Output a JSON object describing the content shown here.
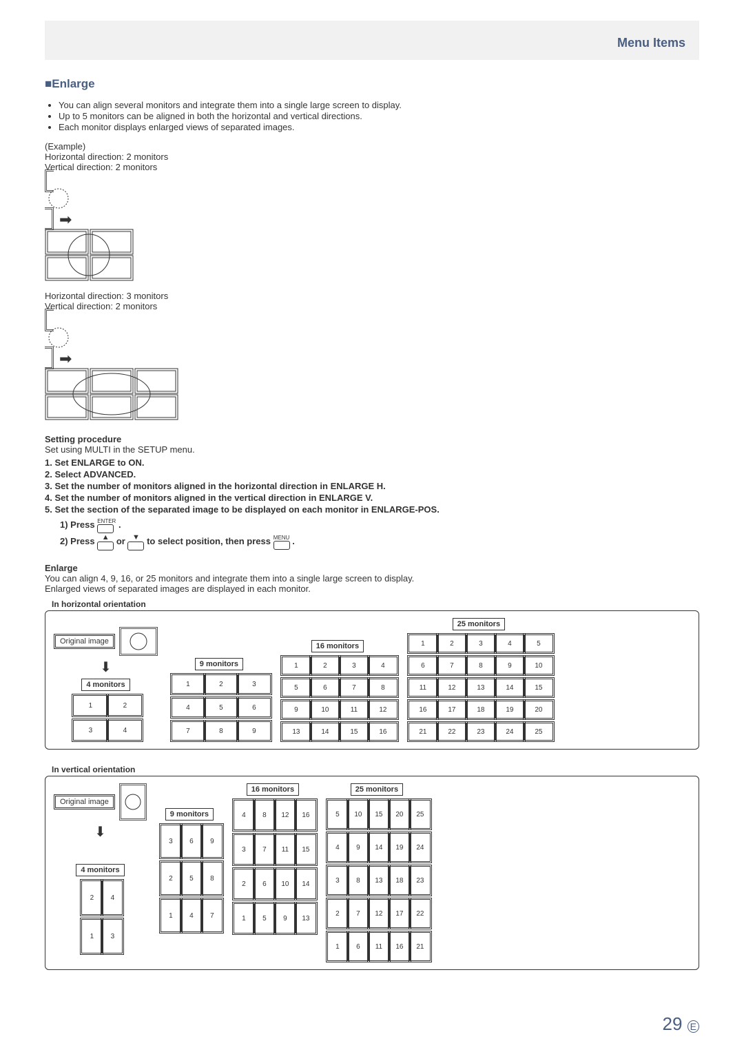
{
  "header": {
    "title": "Menu Items"
  },
  "section": {
    "title": "■Enlarge",
    "bullets": [
      "You can align several monitors and integrate them into a single large screen to display.",
      "Up to 5 monitors can be aligned in both the horizontal and vertical directions.",
      "Each monitor displays enlarged views of separated images."
    ],
    "example_label": "(Example)",
    "ex1": {
      "h": "Horizontal direction: 2 monitors",
      "v": "Vertical direction: 2 monitors"
    },
    "ex2": {
      "h": "Horizontal direction: 3 monitors",
      "v": "Vertical direction: 2 monitors"
    }
  },
  "procedure": {
    "heading": "Setting procedure",
    "intro": "Set using MULTI in the SETUP menu.",
    "steps": [
      "1. Set ENLARGE to ON.",
      "2. Select ADVANCED.",
      "3. Set the number of monitors aligned in the horizontal direction in ENLARGE H.",
      "4. Set the number of monitors aligned in the vertical direction in ENLARGE V.",
      "5. Set the section of the separated image to be displayed on each monitor in ENLARGE-POS."
    ],
    "sub1_pre": "1) Press ",
    "sub1_btn": "ENTER",
    "sub1_post": ".",
    "sub2_pre": "2) Press ",
    "sub2_mid": " or ",
    "sub2_post1": " to select position, then press ",
    "sub2_btn": "MENU",
    "sub2_post2": "."
  },
  "enlarge2": {
    "heading": "Enlarge",
    "line1": "You can align 4, 9, 16, or 25 monitors and integrate them into a single large screen to display.",
    "line2": "Enlarged views of separated images are displayed in each monitor.",
    "h_orient": "In horizontal orientation",
    "v_orient": "In vertical orientation",
    "original": "Original image",
    "labels": {
      "m4": "4 monitors",
      "m9": "9 monitors",
      "m16": "16 monitors",
      "m25": "25 monitors"
    }
  },
  "chart_data": [
    {
      "type": "table",
      "title": "4 monitors horizontal",
      "rows": 2,
      "cols": 2,
      "values": [
        1,
        2,
        3,
        4
      ]
    },
    {
      "type": "table",
      "title": "9 monitors horizontal",
      "rows": 3,
      "cols": 3,
      "values": [
        1,
        2,
        3,
        4,
        5,
        6,
        7,
        8,
        9
      ]
    },
    {
      "type": "table",
      "title": "16 monitors horizontal",
      "rows": 4,
      "cols": 4,
      "values": [
        1,
        2,
        3,
        4,
        5,
        6,
        7,
        8,
        9,
        10,
        11,
        12,
        13,
        14,
        15,
        16
      ]
    },
    {
      "type": "table",
      "title": "25 monitors horizontal",
      "rows": 5,
      "cols": 5,
      "values": [
        1,
        2,
        3,
        4,
        5,
        6,
        7,
        8,
        9,
        10,
        11,
        12,
        13,
        14,
        15,
        16,
        17,
        18,
        19,
        20,
        21,
        22,
        23,
        24,
        25
      ]
    },
    {
      "type": "table",
      "title": "4 monitors vertical",
      "rows": 2,
      "cols": 2,
      "values": [
        2,
        4,
        1,
        3
      ]
    },
    {
      "type": "table",
      "title": "9 monitors vertical",
      "rows": 3,
      "cols": 3,
      "values": [
        3,
        6,
        9,
        2,
        5,
        8,
        1,
        4,
        7
      ]
    },
    {
      "type": "table",
      "title": "16 monitors vertical",
      "rows": 4,
      "cols": 4,
      "values": [
        4,
        8,
        12,
        16,
        3,
        7,
        11,
        15,
        2,
        6,
        10,
        14,
        1,
        5,
        9,
        13
      ]
    },
    {
      "type": "table",
      "title": "25 monitors vertical",
      "rows": 5,
      "cols": 5,
      "values": [
        5,
        10,
        15,
        20,
        25,
        4,
        9,
        14,
        19,
        24,
        3,
        8,
        13,
        18,
        23,
        2,
        7,
        12,
        17,
        22,
        1,
        6,
        11,
        16,
        21
      ]
    }
  ],
  "page_num": "29",
  "page_suffix": "E"
}
